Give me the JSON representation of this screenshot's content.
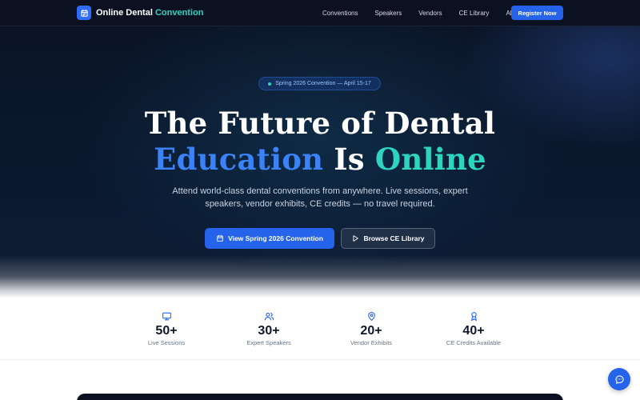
{
  "brand": {
    "name": "Online Dental",
    "accent": "Convention",
    "icon": "calendar-icon",
    "accent_color": "#2dd4bf"
  },
  "nav": {
    "links": [
      "Conventions",
      "Speakers",
      "Vendors",
      "CE Library",
      "About"
    ],
    "cta": "Register Now"
  },
  "hero": {
    "badge": "Spring 2026 Convention — April 15-17",
    "title_line1": "The Future of Dental",
    "title_word1": "Education",
    "title_word2": "Is",
    "title_word3": "Online",
    "subtitle": "Attend world-class dental conventions from anywhere. Live sessions, expert speakers, vendor exhibits, CE credits — no travel required.",
    "primary_button": "View Spring 2026 Convention",
    "primary_icon": "calendar-icon",
    "secondary_button": "Browse CE Library",
    "secondary_icon": "play-icon",
    "colors": {
      "blue": "#3b82f6",
      "teal": "#2dd4bf",
      "background": "#0b1426"
    }
  },
  "stats": [
    {
      "icon": "monitor-icon",
      "value": "50+",
      "label": "Live Sessions"
    },
    {
      "icon": "users-icon",
      "value": "30+",
      "label": "Expert Speakers"
    },
    {
      "icon": "map-pin-icon",
      "value": "20+",
      "label": "Vendor Exhibits"
    },
    {
      "icon": "award-icon",
      "value": "40+",
      "label": "CE Credits Available"
    }
  ],
  "chat": {
    "icon": "chat-icon"
  }
}
